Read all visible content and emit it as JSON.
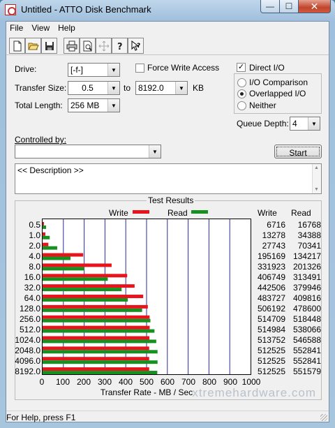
{
  "window": {
    "title": "Untitled - ATTO Disk Benchmark",
    "minimize": "—",
    "maximize": "☐",
    "close": "✕"
  },
  "menu": [
    "File",
    "View",
    "Help"
  ],
  "toolbar": [
    "new-icon",
    "open-icon",
    "save-icon",
    "print-icon",
    "print-preview-icon",
    "move-icon",
    "help-icon",
    "context-help-icon"
  ],
  "form": {
    "drive_label": "Drive:",
    "drive_value": "[-f-]",
    "force_write_label": "Force Write Access",
    "force_write_checked": false,
    "direct_io_label": "Direct I/O",
    "direct_io_checked": true,
    "transfer_size_label": "Transfer Size:",
    "transfer_from": "0.5",
    "to_label": "to",
    "transfer_to": "8192.0",
    "kb_label": "KB",
    "total_length_label": "Total Length:",
    "total_length_value": "256 MB",
    "io_comparison_label": "I/O Comparison",
    "overlapped_io_label": "Overlapped I/O",
    "neither_label": "Neither",
    "selected_mode": "Overlapped I/O",
    "queue_depth_label": "Queue Depth:",
    "queue_depth_value": "4",
    "controlled_by_label": "Controlled by:",
    "controlled_by_value": "",
    "start_label": "Start",
    "description_text": "<< Description >>"
  },
  "results": {
    "title": "Test Results",
    "write_legend": "Write",
    "read_legend": "Read",
    "write_header": "Write",
    "read_header": "Read",
    "write_color": "#e8141c",
    "read_color": "#16901e",
    "x_label": "Transfer Rate - MB / Sec"
  },
  "chart_data": {
    "type": "bar",
    "orientation": "horizontal",
    "categories": [
      "0.5",
      "1.0",
      "2.0",
      "4.0",
      "8.0",
      "16.0",
      "32.0",
      "64.0",
      "128.0",
      "256.0",
      "512.0",
      "1024.0",
      "2048.0",
      "4096.0",
      "8192.0"
    ],
    "series": [
      {
        "name": "Write",
        "values": [
          6716,
          13278,
          27743,
          195169,
          331923,
          406749,
          442506,
          483727,
          506192,
          514709,
          514984,
          513752,
          512525,
          512525,
          512525
        ]
      },
      {
        "name": "Read",
        "values": [
          16768,
          34388,
          70341,
          134217,
          201326,
          313491,
          379946,
          409816,
          478600,
          518448,
          538066,
          546588,
          552841,
          552841,
          551579
        ]
      }
    ],
    "bar_units_divisor": 1000,
    "xlabel": "Transfer Rate - MB / Sec",
    "xlim": [
      0,
      1000
    ],
    "xticks": [
      "0",
      "100",
      "200",
      "300",
      "400",
      "500",
      "600",
      "700",
      "800",
      "900",
      "1000"
    ],
    "grid": true,
    "legend": "top"
  },
  "status": {
    "text": "For Help, press F1",
    "watermark": "xtremehardware.com"
  }
}
